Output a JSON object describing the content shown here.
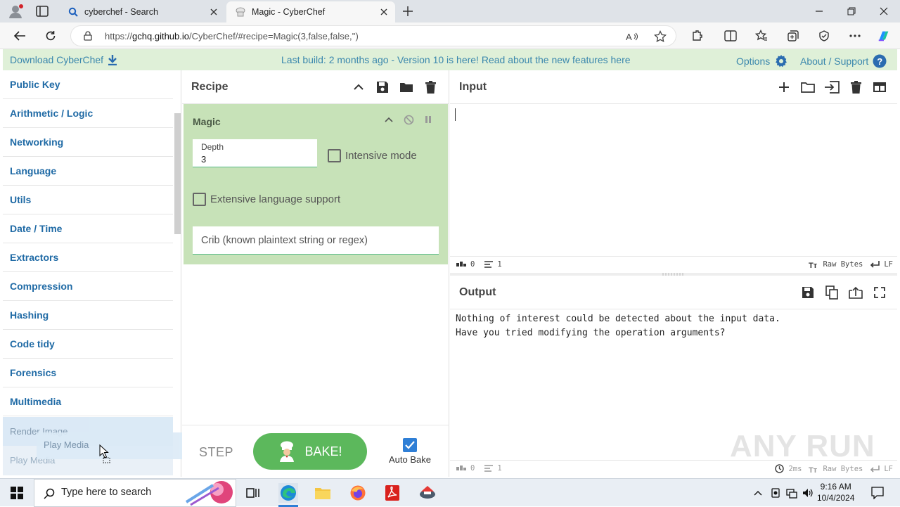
{
  "browser": {
    "tabs": [
      {
        "title": "cyberchef - Search",
        "icon": "search-icon",
        "active": false
      },
      {
        "title": "Magic - CyberChef",
        "icon": "cyberchef-chef-icon",
        "active": true
      }
    ],
    "url_prefix": "https://",
    "url_host": "gchq.github.io",
    "url_path": "/CyberChef/#recipe=Magic(3,false,false,'')"
  },
  "banner": {
    "download_label": "Download CyberChef",
    "message": "Last build: 2 months ago - Version 10 is here! Read about the new features here",
    "options_label": "Options",
    "about_label": "About / Support"
  },
  "operations": {
    "categories": [
      "Public Key",
      "Arithmetic / Logic",
      "Networking",
      "Language",
      "Utils",
      "Date / Time",
      "Extractors",
      "Compression",
      "Hashing",
      "Code tidy",
      "Forensics",
      "Multimedia"
    ],
    "dragging_item_under": "Render Image",
    "dragging_item_next": "Play Media",
    "drag_ghost_label": "Play Media"
  },
  "recipe": {
    "title": "Recipe",
    "operation": {
      "name": "Magic",
      "depth_label": "Depth",
      "depth_value": "3",
      "intensive_mode_label": "Intensive mode",
      "intensive_mode_checked": false,
      "extensive_language_label": "Extensive language support",
      "extensive_language_checked": false,
      "crib_placeholder": "Crib (known plaintext string or regex)"
    },
    "step_label": "STEP",
    "bake_label": "BAKE!",
    "auto_bake_label": "Auto Bake",
    "auto_bake_checked": true
  },
  "input": {
    "title": "Input",
    "value": "",
    "status": {
      "chars": "0",
      "lines": "1",
      "encoding": "Raw Bytes",
      "eol": "LF"
    }
  },
  "output": {
    "title": "Output",
    "text": "Nothing of interest could be detected about the input data.\nHave you tried modifying the operation arguments?",
    "status": {
      "chars": "0",
      "lines": "1",
      "time": "2ms",
      "encoding": "Raw Bytes",
      "eol": "LF"
    }
  },
  "watermark": "ANY RUN",
  "taskbar": {
    "search_placeholder": "Type here to search",
    "time": "9:16 AM",
    "date": "10/4/2024"
  },
  "colors": {
    "banner_bg": "#dff0d8",
    "link_blue": "#3a87ad",
    "category_blue": "#1f6aa5",
    "recipe_op_bg": "#c7e2b8",
    "bake_green": "#5cb85c",
    "checkbox_blue": "#2f7fd6"
  }
}
